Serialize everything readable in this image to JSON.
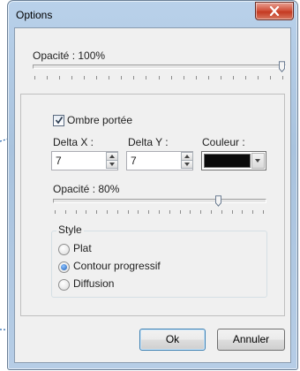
{
  "window": {
    "title": "Options"
  },
  "opacity_main": {
    "label": "Opacité : 100%",
    "value": 100
  },
  "shadow": {
    "checkbox_label": "Ombre portée",
    "checked": true,
    "delta_x": {
      "label": "Delta X :",
      "value": "7"
    },
    "delta_y": {
      "label": "Delta Y :",
      "value": "7"
    },
    "color": {
      "label": "Couleur :",
      "value": "#0a0a0a"
    },
    "opacity": {
      "label": "Opacité : 80%",
      "value": 80
    },
    "style": {
      "label": "Style",
      "options": [
        "Plat",
        "Contour progressif",
        "Diffusion"
      ],
      "selected": "Contour progressif"
    }
  },
  "buttons": {
    "ok": "Ok",
    "cancel": "Annuler"
  },
  "icons": {
    "close": "close-icon",
    "check": "checkmark-icon",
    "spin_up": "arrow-up-icon",
    "spin_down": "arrow-down-icon",
    "dropdown": "chevron-down-icon"
  },
  "colors": {
    "annotation_line": "#1e5fa8",
    "title_bar": "#b9d1ea",
    "close_button": "#c43a22"
  }
}
